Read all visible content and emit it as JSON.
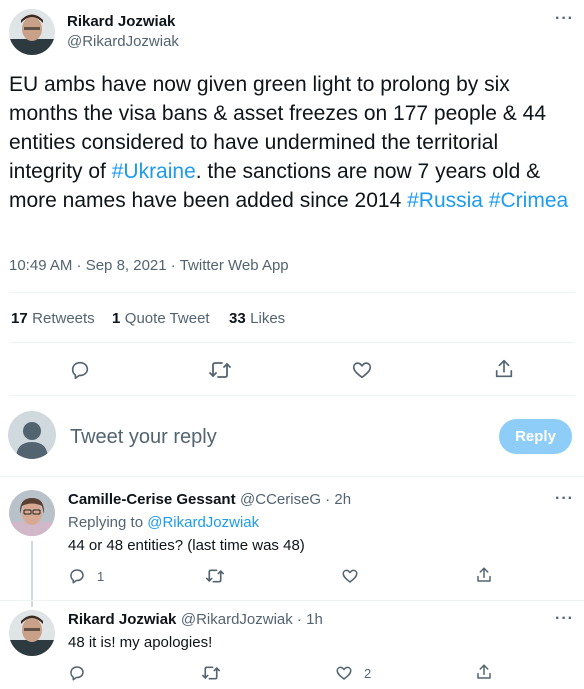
{
  "tweet": {
    "author_name": "Rikard Jozwiak",
    "author_handle": "@RikardJozwiak",
    "text_before": "EU ambs have now given green light to prolong by six months the visa bans & asset freezes on 177 people & 44 entities considered to have undermined the territorial integrity of ",
    "hashtag_ukraine": "#Ukraine",
    "text_after": ". the sanctions are now 7 years old & more names have been added since 2014 ",
    "hashtag_russia": "#Russia",
    "hashtag_crimea": "#Crimea",
    "time": "10:49 AM · Sep 8, 2021",
    "sep": " · ",
    "source": "Twitter Web App",
    "more": "···"
  },
  "stats": {
    "retweets_count": "17",
    "retweets_label": "Retweets",
    "quotes_count": "1",
    "quotes_label": "Quote Tweet",
    "likes_count": "33",
    "likes_label": "Likes"
  },
  "compose": {
    "placeholder": "Tweet your reply",
    "button": "Reply"
  },
  "replies": [
    {
      "name": "Camille-Cerise Gessant",
      "handle_time": "@CCeriseG · 2h",
      "replying_prefix": "Replying to ",
      "replying_to": "@RikardJozwiak",
      "text": "44 or 48 entities? (last time was 48)",
      "reply_count": "1",
      "like_count": "",
      "more": "···"
    },
    {
      "name": "Rikard Jozwiak",
      "handle_time": "@RikardJozwiak · 1h",
      "text": "48 it is! my apologies!",
      "reply_count": "",
      "like_count": "2",
      "more": "···"
    }
  ],
  "colors": {
    "accent": "#1d9bf0",
    "reply_button_disabled": "#8ecdf8",
    "muted": "#536471"
  }
}
